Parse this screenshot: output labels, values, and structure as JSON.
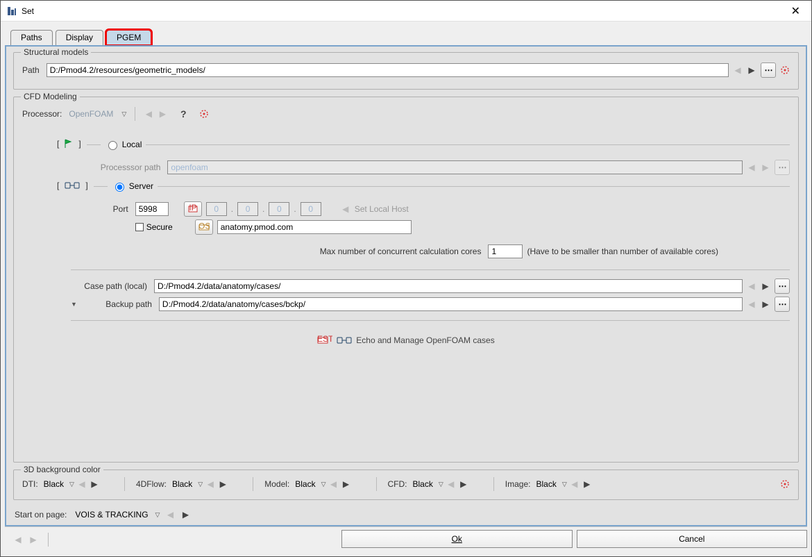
{
  "window": {
    "title": "Set"
  },
  "tabs": {
    "t0": "Paths",
    "t1": "Display",
    "t2": "PGEM",
    "active": 2
  },
  "structural": {
    "title": "Structural models",
    "path_label": "Path",
    "path_value": "D:/Pmod4.2/resources/geometric_models/"
  },
  "cfd": {
    "title": "CFD Modeling",
    "processor_label": "Processor:",
    "processor_value": "OpenFOAM",
    "local_label": "Local",
    "processor_path_label": "Processsor path",
    "processor_path_value": "openfoam",
    "server_label": "Server",
    "port_label": "Port",
    "port_value": "5998",
    "ip": {
      "a": "0",
      "b": "0",
      "c": "0",
      "d": "0"
    },
    "set_local_host": "Set Local Host",
    "secure_label": "Secure",
    "host_value": "anatomy.pmod.com",
    "max_cores_label": "Max number of concurrent calculation cores",
    "max_cores_value": "1",
    "max_cores_hint": "(Have to be smaller than number of available cores)",
    "case_path_label": "Case path (local)",
    "case_path_value": "D:/Pmod4.2/data/anatomy/cases/",
    "backup_path_label": "Backup path",
    "backup_path_value": "D:/Pmod4.2/data/anatomy/cases/bckp/",
    "echo_label": "Echo and Manage OpenFOAM cases"
  },
  "bg3d": {
    "title": "3D background color",
    "dti_label": "DTI:",
    "dti_value": "Black",
    "flow_label": "4DFlow:",
    "flow_value": "Black",
    "model_label": "Model:",
    "model_value": "Black",
    "cfd_label": "CFD:",
    "cfd_value": "Black",
    "image_label": "Image:",
    "image_value": "Black"
  },
  "start": {
    "label": "Start on page:",
    "value": "VOIS & TRACKING"
  },
  "footer": {
    "ok": "Ok",
    "cancel": "Cancel"
  }
}
